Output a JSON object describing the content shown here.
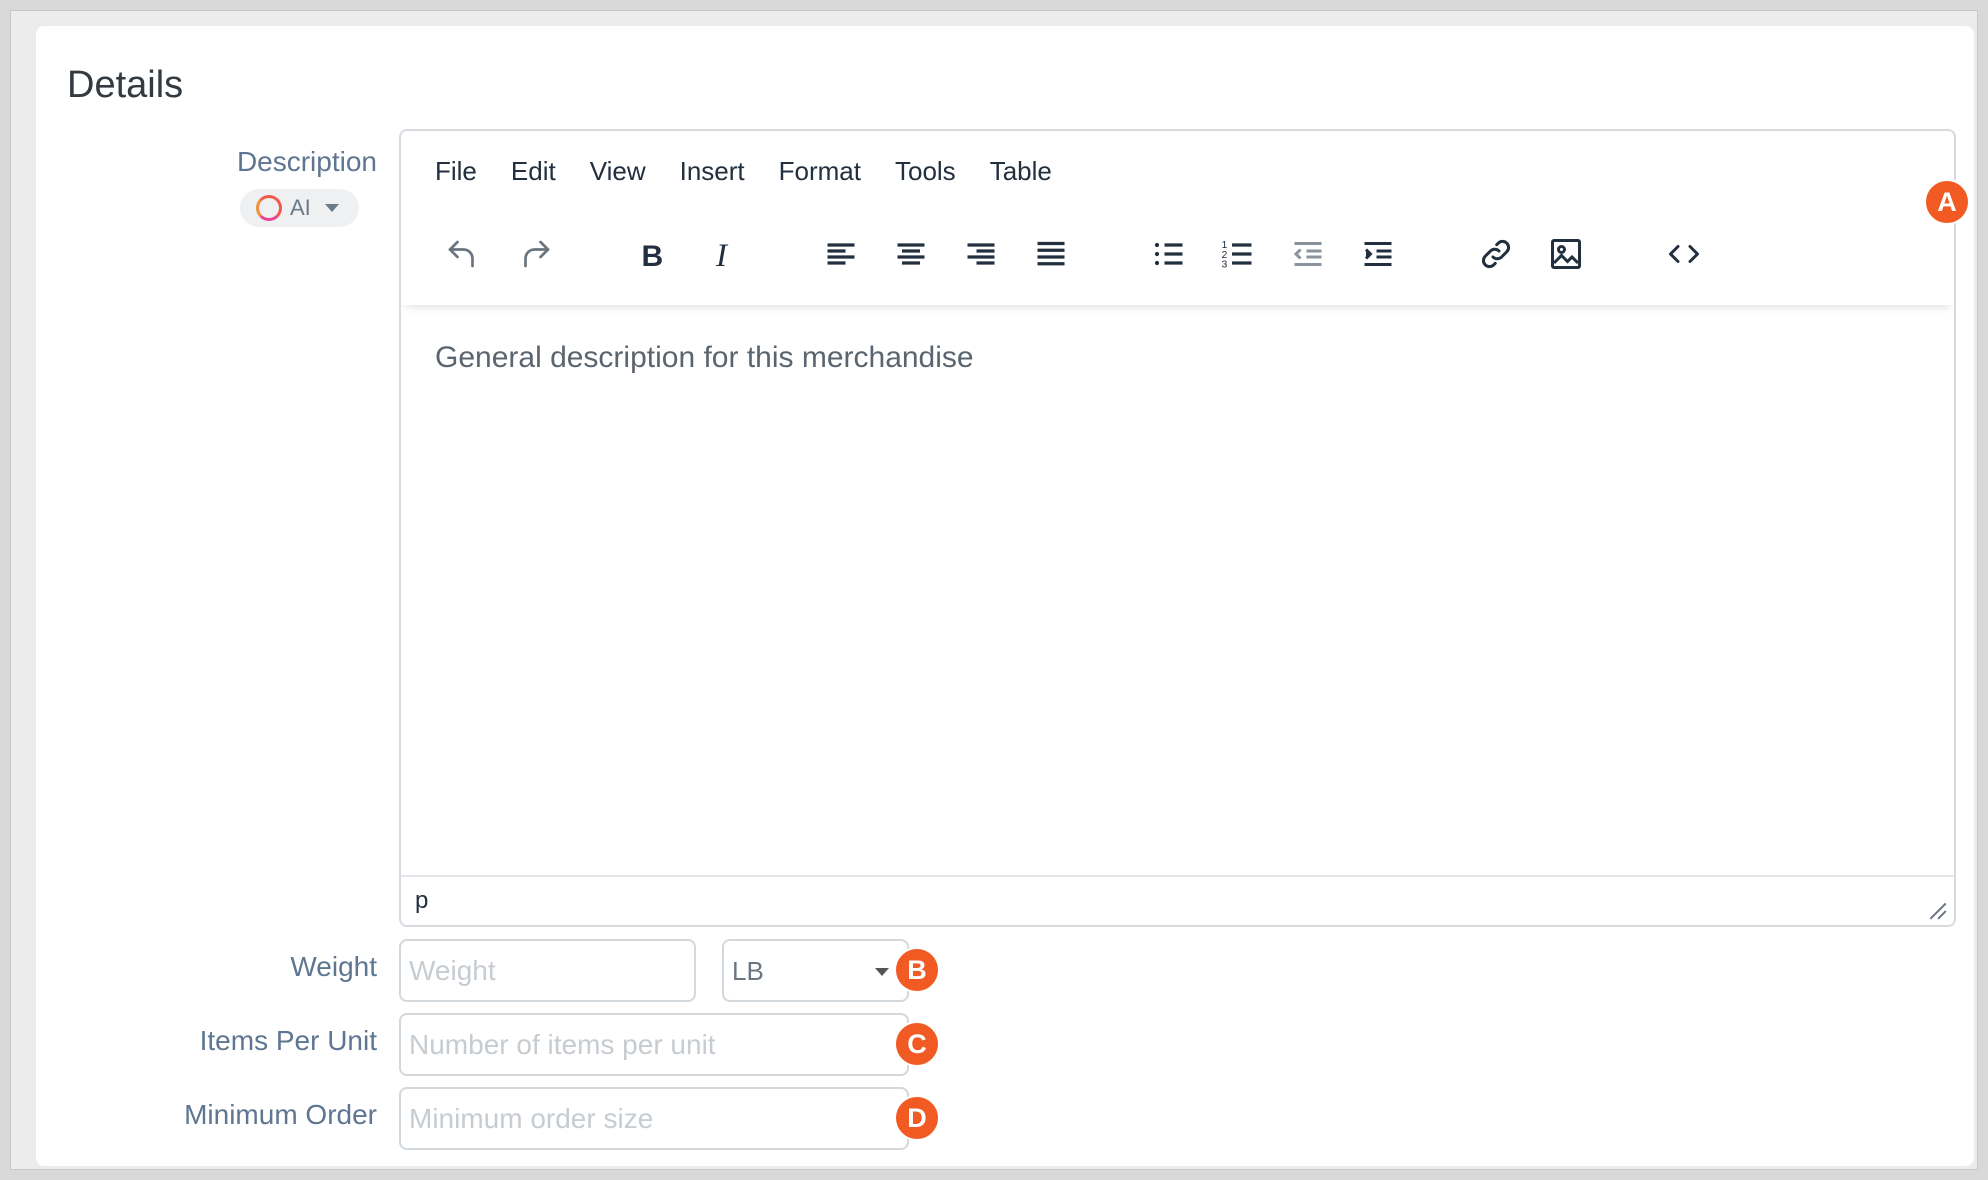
{
  "section": {
    "title": "Details"
  },
  "description": {
    "label": "Description",
    "ai_button": {
      "label": "AI"
    },
    "editor": {
      "menu": [
        "File",
        "Edit",
        "View",
        "Insert",
        "Format",
        "Tools",
        "Table"
      ],
      "toolbar": [
        {
          "name": "undo-button",
          "icon": "undo-icon"
        },
        {
          "name": "redo-button",
          "icon": "redo-icon"
        },
        {
          "name": "bold-button",
          "icon": "bold-icon"
        },
        {
          "name": "italic-button",
          "icon": "italic-icon"
        },
        {
          "name": "align-left-button",
          "icon": "align-left-icon"
        },
        {
          "name": "align-center-button",
          "icon": "align-center-icon"
        },
        {
          "name": "align-right-button",
          "icon": "align-right-icon"
        },
        {
          "name": "justify-button",
          "icon": "justify-icon"
        },
        {
          "name": "bullet-list-button",
          "icon": "bullet-list-icon"
        },
        {
          "name": "numbered-list-button",
          "icon": "numbered-list-icon"
        },
        {
          "name": "outdent-button",
          "icon": "outdent-icon"
        },
        {
          "name": "indent-button",
          "icon": "indent-icon"
        },
        {
          "name": "link-button",
          "icon": "link-icon"
        },
        {
          "name": "image-button",
          "icon": "image-icon"
        },
        {
          "name": "source-code-button",
          "icon": "code-icon"
        }
      ],
      "content": "General description for this merchandise",
      "status_path": "p"
    }
  },
  "weight": {
    "label": "Weight",
    "placeholder": "Weight",
    "unit": "LB"
  },
  "items_per_unit": {
    "label": "Items Per Unit",
    "placeholder": "Number of items per unit"
  },
  "minimum_order": {
    "label": "Minimum Order",
    "placeholder": "Minimum order size"
  },
  "callouts": {
    "a": "A",
    "b": "B",
    "c": "C",
    "d": "D"
  },
  "colors": {
    "accent": "#f15a22",
    "label": "#5e7691",
    "text": "#222f3e",
    "border": "#d7dbe0"
  }
}
